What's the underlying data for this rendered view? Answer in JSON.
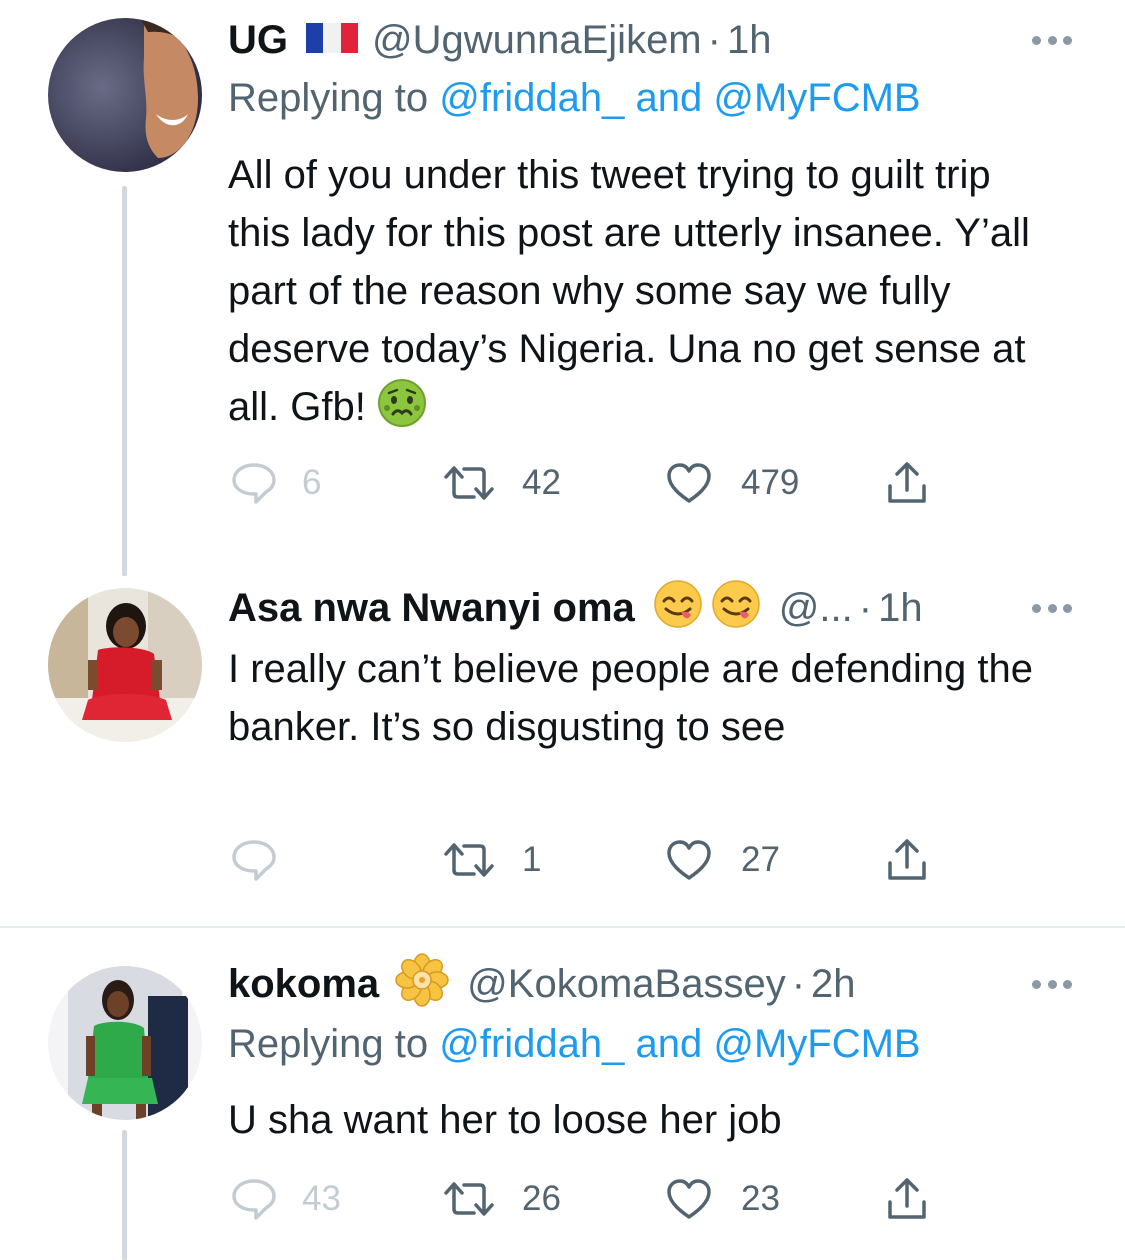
{
  "tweets": [
    {
      "name": "UG",
      "flag_icon": "france-flag-icon",
      "handle": "@UgwunnaEjikem",
      "dot": "·",
      "time": "1h",
      "replying_prefix": "Replying to ",
      "replying_user1": "@friddah_",
      "replying_and": " and ",
      "replying_user2": "@MyFCMB",
      "text": "All of you under this tweet trying to guilt trip this lady for this post are utterly insanee. Y’all part of the reason why some say we fully deserve today’s Nigeria. Una no get sense at all. Gfb!",
      "text_emoji": "nauseated-face-icon",
      "replies": "6",
      "retweets": "42",
      "likes": "479"
    },
    {
      "name": "Asa nwa Nwanyi oma",
      "name_emojis": [
        "face-savoring-food-icon",
        "face-savoring-food-icon"
      ],
      "handle": "@...",
      "dot": "·",
      "time": "1h",
      "text": "I really can’t believe people are defending the banker. It’s so disgusting to see",
      "replies": "",
      "retweets": "1",
      "likes": "27"
    },
    {
      "name": "kokoma",
      "name_emoji": "blossom-icon",
      "handle": "@KokomaBassey",
      "dot": "·",
      "time": "2h",
      "replying_prefix": "Replying to ",
      "replying_user1": "@friddah_",
      "replying_and": " and ",
      "replying_user2": "@MyFCMB",
      "text": "U sha want her to loose her job",
      "replies": "43",
      "retweets": "26",
      "likes": "23"
    }
  ],
  "colors": {
    "link": "#1d9bf0",
    "secondary_text": "#536471",
    "faint_text": "#c4ccd3",
    "thread_line": "#cfd9de",
    "divider": "#e6ecf0"
  }
}
